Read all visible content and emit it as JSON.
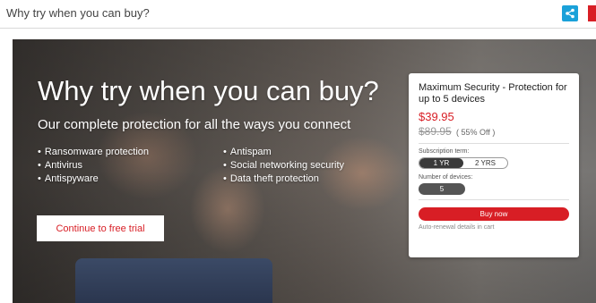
{
  "header": {
    "title": "Why try when you can buy?",
    "share_icon": "share-icon",
    "accent": "#d81e25",
    "share_color": "#1aa1d9"
  },
  "hero": {
    "headline": "Why try when you can buy?",
    "subtitle": "Our complete protection for all the ways you connect",
    "features_col1": [
      "Ransomware protection",
      "Antivirus",
      "Antispyware"
    ],
    "features_col2": [
      "Antispam",
      "Social networking security",
      "Data theft protection"
    ],
    "cta_label": "Continue to free trial"
  },
  "offer": {
    "product": "Maximum Security - Protection for up to 5 devices",
    "price": "$39.95",
    "old_price": "$89.95",
    "discount": "( 55% Off )",
    "term_label": "Subscription term:",
    "terms": [
      "1 YR",
      "2 YRS"
    ],
    "selected_term": "1 YR",
    "devices_label": "Number of devices:",
    "devices_value": "5",
    "buy_label": "Buy now",
    "renewal_note": "Auto-renewal details in cart"
  }
}
